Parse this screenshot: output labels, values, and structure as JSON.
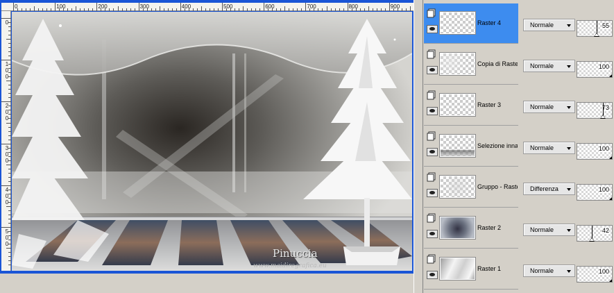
{
  "ruler": {
    "top_labels": [
      "0",
      "100",
      "200",
      "300",
      "400",
      "500",
      "600",
      "700",
      "800",
      "900"
    ],
    "left_labels": [
      "0",
      "1\n0\n0",
      "2\n0\n0",
      "3\n0\n0",
      "4\n0\n0",
      "5\n0\n0"
    ]
  },
  "canvas": {
    "watermark_title": "Pinuccia",
    "watermark_url": "www.maidiregrafica.eu"
  },
  "layers": [
    {
      "name": "Raster 4",
      "blend_mode": "Normale",
      "opacity": 55,
      "selected": true,
      "thumb": "transparent"
    },
    {
      "name": "Copia di Raster",
      "blend_mode": "Normale",
      "opacity": 100,
      "selected": false,
      "thumb": "transparent-light"
    },
    {
      "name": "Raster 3",
      "blend_mode": "Normale",
      "opacity": 73,
      "selected": false,
      "thumb": "transparent"
    },
    {
      "name": "Selezione inna",
      "blend_mode": "Normale",
      "opacity": 100,
      "selected": false,
      "thumb": "strip"
    },
    {
      "name": "Gruppo - Raste",
      "blend_mode": "Differenza",
      "opacity": 100,
      "selected": false,
      "thumb": "faint"
    },
    {
      "name": "Raster 2",
      "blend_mode": "Normale",
      "opacity": 42,
      "selected": false,
      "thumb": "photo"
    },
    {
      "name": "Raster 1",
      "blend_mode": "Normale",
      "opacity": 100,
      "selected": false,
      "thumb": "gradient"
    }
  ],
  "colors": {
    "window_frame": "#1a55d6",
    "selected_layer": "#3d8cef",
    "panel_bg": "#d4d0c8"
  },
  "icons": {
    "layer_group": "layer-group-icon",
    "visibility": "eye-icon",
    "blend_dropdown": "chevron-down-icon"
  }
}
